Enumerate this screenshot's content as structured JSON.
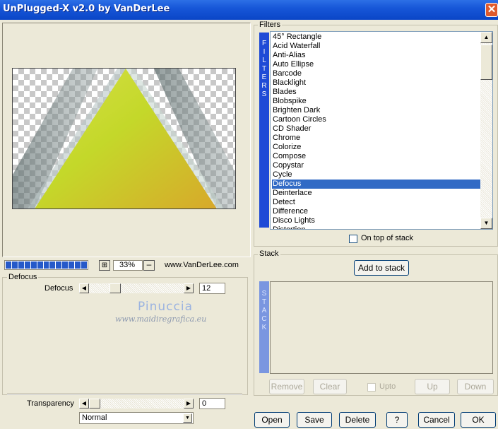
{
  "window": {
    "title": "UnPlugged-X v2.0 by VanDerLee",
    "close_glyph": "✕"
  },
  "preview": {
    "zoom": "33%",
    "zoom_minus": "–",
    "zoom_icon_glyph": "⊞",
    "website": "www.VanDerLee.com",
    "progress_segments": 13
  },
  "params": {
    "group_label": "Defocus",
    "defocus": {
      "label": "Defocus",
      "value": "12"
    },
    "transparency": {
      "label": "Transparency",
      "value": "0"
    },
    "blend_mode": "Normal"
  },
  "watermark": {
    "line1": "Pinuccia",
    "line2": "www.maidiregrafica.eu"
  },
  "filters": {
    "group_label": "Filters",
    "strip_letters": [
      "F",
      "I",
      "L",
      "T",
      "E",
      "R",
      "S"
    ],
    "items": [
      "45° Rectangle",
      "Acid Waterfall",
      "Anti-Alias",
      "Auto Ellipse",
      "Barcode",
      "Blacklight",
      "Blades",
      "Blobspike",
      "Brighten Dark",
      "Cartoon Circles",
      "CD Shader",
      "Chrome",
      "Colorize",
      "Compose",
      "Copystar",
      "Cycle",
      "Defocus",
      "Deinterlace",
      "Detect",
      "Difference",
      "Disco Lights",
      "Distortion"
    ],
    "selected_index": 16,
    "on_top_label": "On top of stack"
  },
  "stack": {
    "group_label": "Stack",
    "add_button": "Add to stack",
    "strip_letters": [
      "S",
      "T",
      "A",
      "C",
      "K"
    ],
    "remove_button": "Remove",
    "clear_button": "Clear",
    "upto_label": "Upto",
    "up_button": "Up",
    "down_button": "Down"
  },
  "footer": {
    "open": "Open",
    "save": "Save",
    "delete": "Delete",
    "help": "?",
    "cancel": "Cancel",
    "ok": "OK"
  },
  "icons": {
    "scroll_up": "▲",
    "scroll_down": "▼",
    "scroll_left": "◀",
    "scroll_right": "▶",
    "dropdown": "▼"
  },
  "colors": {
    "titlebar": "#0a45c7",
    "selection": "#316ac5",
    "filter_strip": "#1f4ad6",
    "stack_strip": "#7a96e0",
    "progress": "#2659c9"
  }
}
